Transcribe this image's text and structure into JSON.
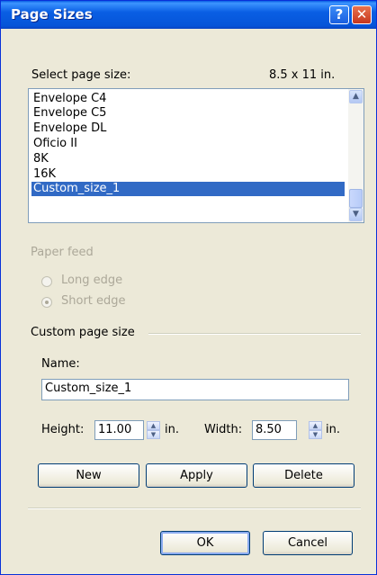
{
  "window": {
    "title": "Page Sizes"
  },
  "titlebar": {
    "help_glyph": "?",
    "close_glyph": "✕"
  },
  "select_page_size": {
    "label": "Select page size:",
    "current_size": "8.5 x 11 in.",
    "items": [
      {
        "label": "Envelope C4",
        "selected": false
      },
      {
        "label": "Envelope C5",
        "selected": false
      },
      {
        "label": "Envelope DL",
        "selected": false
      },
      {
        "label": "Oficio II",
        "selected": false
      },
      {
        "label": "8K",
        "selected": false
      },
      {
        "label": "16K",
        "selected": false
      },
      {
        "label": "Custom_size_1",
        "selected": true
      }
    ]
  },
  "paper_feed": {
    "label": "Paper feed",
    "long_edge": "Long edge",
    "short_edge": "Short edge",
    "selected": "short_edge",
    "enabled": false
  },
  "custom_page_size": {
    "label": "Custom page size",
    "name_label": "Name:",
    "name_value": "Custom_size_1",
    "height_label": "Height:",
    "height_value": "11.00",
    "width_label": "Width:",
    "width_value": "8.50",
    "unit": "in."
  },
  "buttons": {
    "new": "New",
    "apply": "Apply",
    "delete": "Delete",
    "ok": "OK",
    "cancel": "Cancel"
  },
  "colors": {
    "titlebar": "#0a5fe4",
    "selection": "#316ac5",
    "dialog_bg": "#ece9d8"
  }
}
